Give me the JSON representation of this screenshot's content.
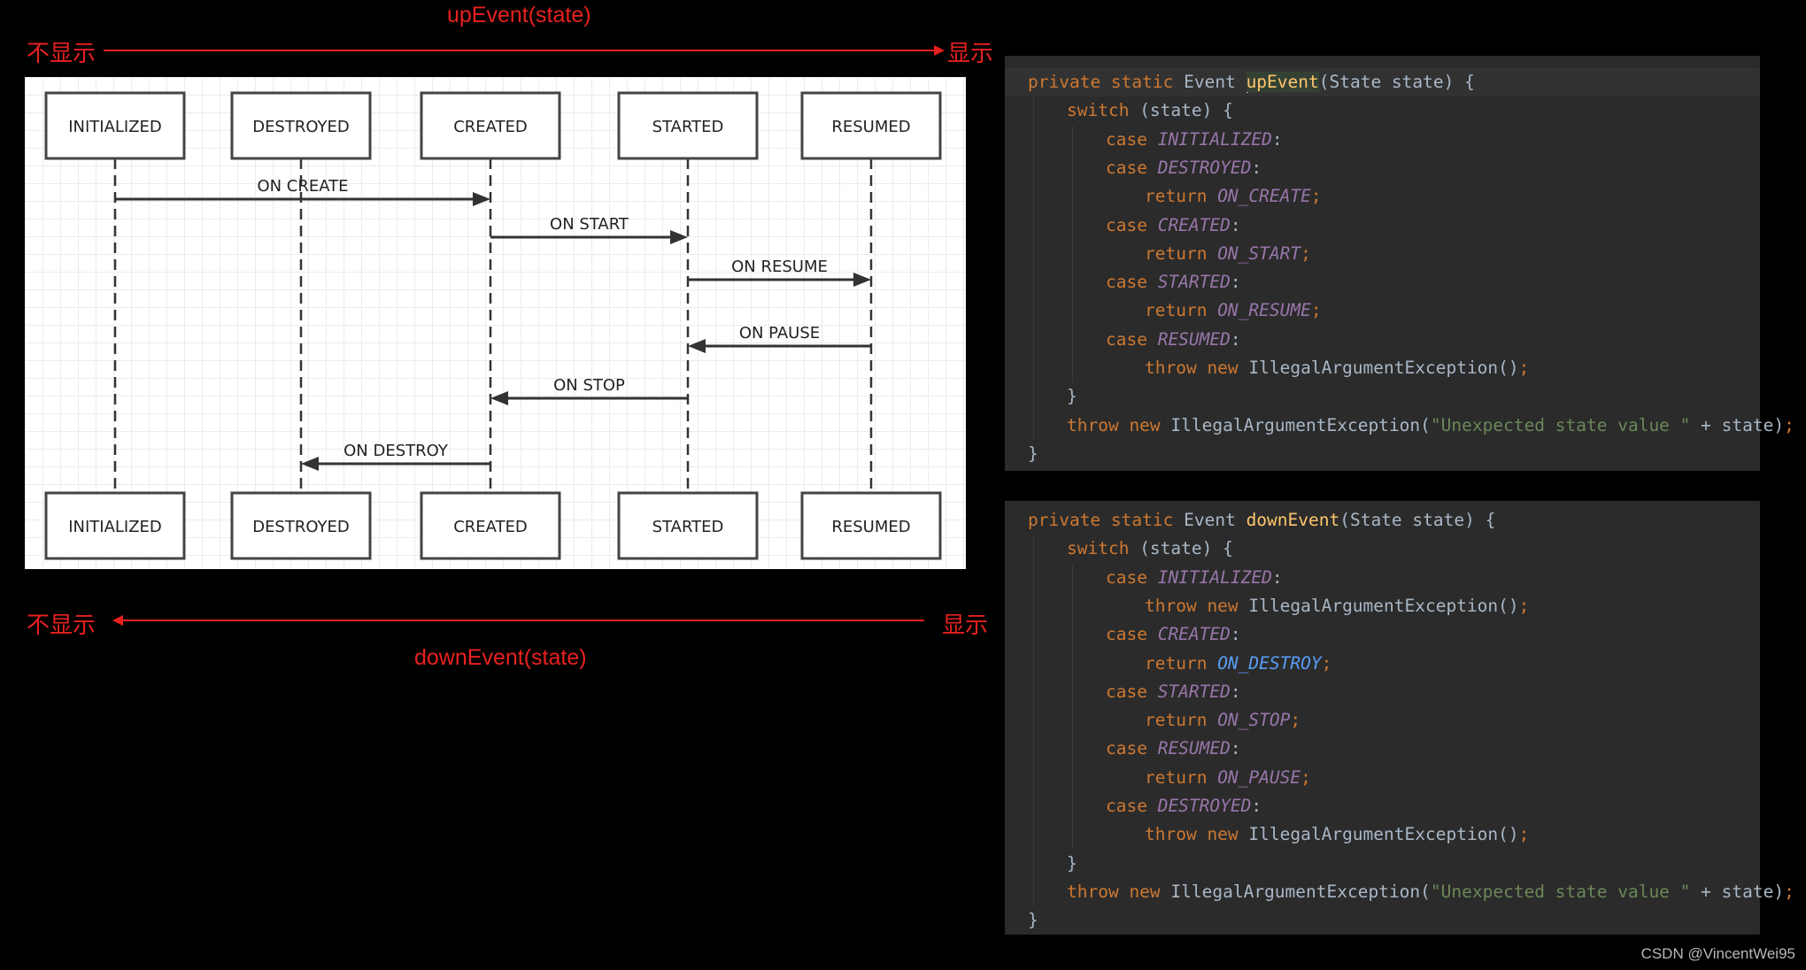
{
  "annotations": {
    "up": {
      "function_label": "upEvent(state)",
      "left_label": "不显示",
      "right_label": "显示",
      "direction": "right"
    },
    "down": {
      "function_label": "downEvent(state)",
      "left_label": "不显示",
      "right_label": "显示",
      "direction": "left"
    },
    "color": "#e8211f"
  },
  "diagram": {
    "states": [
      "INITIALIZED",
      "DESTROYED",
      "CREATED",
      "STARTED",
      "RESUMED"
    ],
    "messages": [
      {
        "label": "ON CREATE",
        "from": "INITIALIZED",
        "to": "CREATED"
      },
      {
        "label": "ON START",
        "from": "CREATED",
        "to": "STARTED"
      },
      {
        "label": "ON RESUME",
        "from": "STARTED",
        "to": "RESUMED"
      },
      {
        "label": "ON PAUSE",
        "from": "RESUMED",
        "to": "STARTED"
      },
      {
        "label": "ON STOP",
        "from": "STARTED",
        "to": "CREATED"
      },
      {
        "label": "ON DESTROY",
        "from": "CREATED",
        "to": "DESTROYED"
      }
    ]
  },
  "code": {
    "up_event": {
      "signature": {
        "mod1": "private",
        "mod2": "static",
        "type": "Event",
        "name": "upEvent",
        "params": "(State state) {"
      },
      "lines": [
        {
          "indent": 1,
          "tokens": [
            [
              "kw",
              "switch"
            ],
            [
              "pl",
              " (state) {"
            ]
          ]
        },
        {
          "indent": 2,
          "tokens": [
            [
              "kw",
              "case "
            ],
            [
              "en",
              "INITIALIZED"
            ],
            [
              "pl",
              ":"
            ]
          ]
        },
        {
          "indent": 2,
          "tokens": [
            [
              "kw",
              "case "
            ],
            [
              "en",
              "DESTROYED"
            ],
            [
              "pl",
              ":"
            ]
          ]
        },
        {
          "indent": 3,
          "tokens": [
            [
              "kw",
              "return "
            ],
            [
              "en",
              "ON_CREATE"
            ],
            [
              "sc",
              ";"
            ]
          ]
        },
        {
          "indent": 2,
          "tokens": [
            [
              "kw",
              "case "
            ],
            [
              "en",
              "CREATED"
            ],
            [
              "pl",
              ":"
            ]
          ]
        },
        {
          "indent": 3,
          "tokens": [
            [
              "kw",
              "return "
            ],
            [
              "en",
              "ON_START"
            ],
            [
              "sc",
              ";"
            ]
          ]
        },
        {
          "indent": 2,
          "tokens": [
            [
              "kw",
              "case "
            ],
            [
              "en",
              "STARTED"
            ],
            [
              "pl",
              ":"
            ]
          ]
        },
        {
          "indent": 3,
          "tokens": [
            [
              "kw",
              "return "
            ],
            [
              "en",
              "ON_RESUME"
            ],
            [
              "sc",
              ";"
            ]
          ]
        },
        {
          "indent": 2,
          "tokens": [
            [
              "kw",
              "case "
            ],
            [
              "en",
              "RESUMED"
            ],
            [
              "pl",
              ":"
            ]
          ]
        },
        {
          "indent": 3,
          "tokens": [
            [
              "kw",
              "throw new "
            ],
            [
              "pl",
              "IllegalArgumentException()"
            ],
            [
              "sc",
              ";"
            ]
          ]
        },
        {
          "indent": 1,
          "tokens": [
            [
              "pl",
              "}"
            ]
          ]
        },
        {
          "indent": 1,
          "tokens": [
            [
              "kw",
              "throw new "
            ],
            [
              "pl",
              "IllegalArgumentException("
            ],
            [
              "str",
              "\"Unexpected state value \""
            ],
            [
              "pl",
              " + state)"
            ],
            [
              "sc",
              ";"
            ]
          ]
        },
        {
          "indent": 0,
          "tokens": [
            [
              "pl",
              "}"
            ]
          ]
        }
      ]
    },
    "down_event": {
      "signature": {
        "mod1": "private",
        "mod2": "static",
        "type": "Event",
        "name": "downEvent",
        "params": "(State state) {"
      },
      "lines": [
        {
          "indent": 1,
          "tokens": [
            [
              "kw",
              "switch"
            ],
            [
              "pl",
              " (state) {"
            ]
          ]
        },
        {
          "indent": 2,
          "tokens": [
            [
              "kw",
              "case "
            ],
            [
              "en",
              "INITIALIZED"
            ],
            [
              "pl",
              ":"
            ]
          ]
        },
        {
          "indent": 3,
          "tokens": [
            [
              "kw",
              "throw new "
            ],
            [
              "pl",
              "IllegalArgumentException()"
            ],
            [
              "sc",
              ";"
            ]
          ]
        },
        {
          "indent": 2,
          "tokens": [
            [
              "kw",
              "case "
            ],
            [
              "en",
              "CREATED"
            ],
            [
              "pl",
              ":"
            ]
          ]
        },
        {
          "indent": 3,
          "tokens": [
            [
              "kw",
              "return "
            ],
            [
              "enb",
              "ON_DESTROY"
            ],
            [
              "sc",
              ";"
            ]
          ]
        },
        {
          "indent": 2,
          "tokens": [
            [
              "kw",
              "case "
            ],
            [
              "en",
              "STARTED"
            ],
            [
              "pl",
              ":"
            ]
          ]
        },
        {
          "indent": 3,
          "tokens": [
            [
              "kw",
              "return "
            ],
            [
              "en",
              "ON_STOP"
            ],
            [
              "sc",
              ";"
            ]
          ]
        },
        {
          "indent": 2,
          "tokens": [
            [
              "kw",
              "case "
            ],
            [
              "en",
              "RESUMED"
            ],
            [
              "pl",
              ":"
            ]
          ]
        },
        {
          "indent": 3,
          "tokens": [
            [
              "kw",
              "return "
            ],
            [
              "en",
              "ON_PAUSE"
            ],
            [
              "sc",
              ";"
            ]
          ]
        },
        {
          "indent": 2,
          "tokens": [
            [
              "kw",
              "case "
            ],
            [
              "en",
              "DESTROYED"
            ],
            [
              "pl",
              ":"
            ]
          ]
        },
        {
          "indent": 3,
          "tokens": [
            [
              "kw",
              "throw new "
            ],
            [
              "pl",
              "IllegalArgumentException()"
            ],
            [
              "sc",
              ";"
            ]
          ]
        },
        {
          "indent": 1,
          "tokens": [
            [
              "pl",
              "}"
            ]
          ]
        },
        {
          "indent": 1,
          "tokens": [
            [
              "kw",
              "throw new "
            ],
            [
              "pl",
              "IllegalArgumentException("
            ],
            [
              "str",
              "\"Unexpected state value \""
            ],
            [
              "pl",
              " + state)"
            ],
            [
              "sc",
              ";"
            ]
          ]
        },
        {
          "indent": 0,
          "tokens": [
            [
              "pl",
              "}"
            ]
          ]
        }
      ]
    }
  },
  "watermark": "CSDN @VincentWei95"
}
